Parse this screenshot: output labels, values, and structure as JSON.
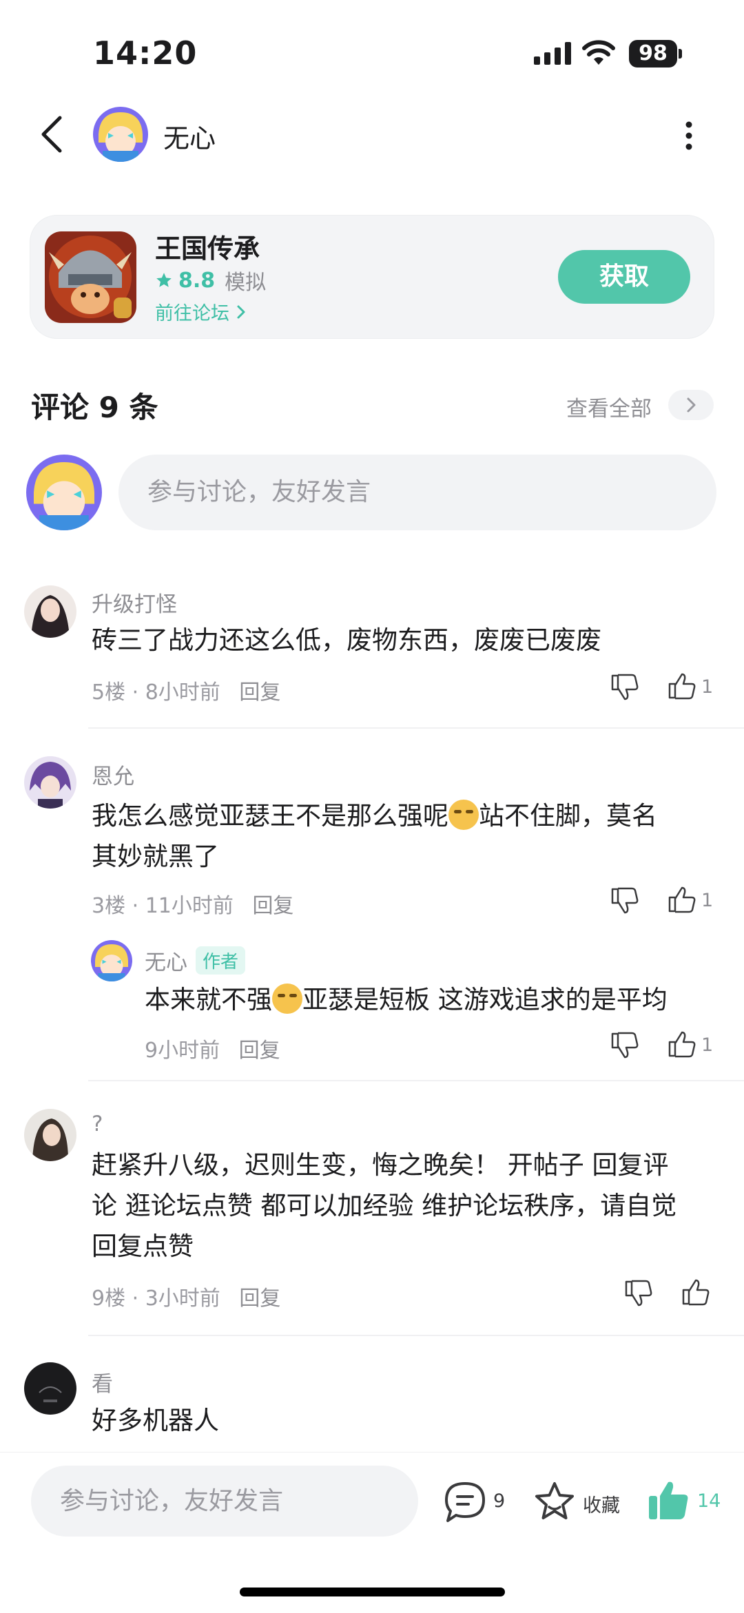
{
  "status_bar": {
    "time": "14:20",
    "battery": "98"
  },
  "header": {
    "username": "无心"
  },
  "game_card": {
    "title": "王国传承",
    "rating": "8.8",
    "genre": "模拟",
    "forum_link": "前往论坛",
    "get_button": "获取"
  },
  "comments_section": {
    "title": "评论 9 条",
    "view_all": "查看全部",
    "input_placeholder": "参与讨论，友好发言"
  },
  "comments": [
    {
      "user": "升级打怪",
      "text": "砖三了战力还这么低，废物东西，废废已废废",
      "floor": "5楼",
      "time": "8小时前",
      "reply": "回复",
      "likes": "1"
    },
    {
      "user": "恩允",
      "text_before": "我怎么感觉亚瑟王不是那么强呢",
      "text_after": "站不住脚，莫名",
      "text_line2": "其妙就黑了",
      "floor": "3楼",
      "time": "11小时前",
      "reply": "回复",
      "likes": "1",
      "sub_reply": {
        "user": "无心",
        "badge": "作者",
        "text_before": "本来就不强",
        "text_after": "亚瑟是短板 这游戏追求的是平均",
        "time": "9小时前",
        "reply": "回复",
        "likes": "1"
      }
    },
    {
      "user": "?",
      "line1": "赶紧升八级，迟则生变，悔之晚矣！ 开帖子 回复评",
      "line2": "论 逛论坛点赞 都可以加经验 维护论坛秩序，请自觉",
      "line3": "回复点赞",
      "floor": "9楼",
      "time": "3小时前",
      "reply": "回复"
    },
    {
      "user": "看",
      "text": "好多机器人"
    }
  ],
  "bottom_bar": {
    "placeholder": "参与讨论，友好发言",
    "comment_count": "9",
    "favorite_label": "收藏",
    "like_count": "14"
  },
  "colors": {
    "accent": "#52c6aa",
    "accent_text": "#3fbfa6"
  }
}
